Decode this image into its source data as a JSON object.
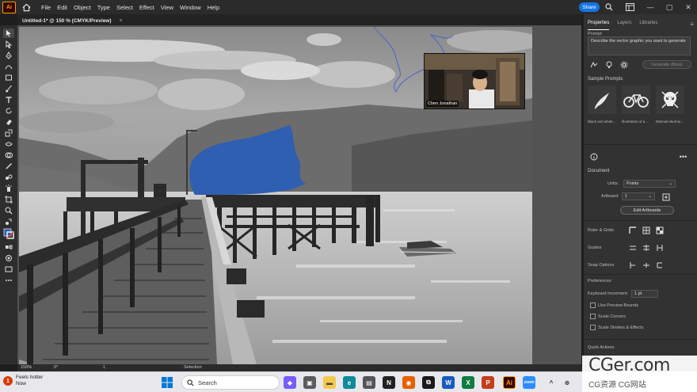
{
  "app": {
    "logo": "Ai",
    "menu": [
      "File",
      "Edit",
      "Object",
      "Type",
      "Select",
      "Effect",
      "View",
      "Window",
      "Help"
    ],
    "share_label": "Share"
  },
  "document": {
    "tab_title": "Untitled-1* @ 150 % (CMYK/Preview)",
    "close_glyph": "×"
  },
  "webcam": {
    "name": "Chen Jonathan"
  },
  "panel": {
    "tabs": [
      "Properties",
      "Layers",
      "Libraries"
    ],
    "prompt_header": "Prompt",
    "prompt_placeholder": "Describe the vector graphic you want to generate",
    "generate_label": "Generate (Beta)",
    "sample_prompts_title": "Sample Prompts",
    "samples": [
      {
        "caption": "Black and white...",
        "icon": "bird-icon"
      },
      {
        "caption": "Illustration of a...",
        "icon": "bicycle-icon"
      },
      {
        "caption": "Minimal skull wi...",
        "icon": "skull-icon"
      }
    ],
    "document_title": "Document",
    "units_label": "Units:",
    "units_value": "Points",
    "artboard_label": "Artboard:",
    "artboard_value": "1",
    "edit_artboards_label": "Edit Artboards",
    "ruler_grids_label": "Ruler & Grids",
    "guides_label": "Guides",
    "snap_options_label": "Snap Options",
    "preferences_title": "Preferences",
    "keyboard_increment_label": "Keyboard Increment:",
    "keyboard_increment_value": "1 pt",
    "checkboxes": [
      "Use Preview Bounds",
      "Scale Corners",
      "Scale Strokes & Effects"
    ],
    "quick_actions_title": "Quick Actions"
  },
  "status": {
    "zoom": "150%",
    "rotation": "0°",
    "artboard_nav": "1",
    "tool": "Selection"
  },
  "taskbar": {
    "weather_line1": "Feels hotter",
    "weather_line2": "Now",
    "weather_badge": "1",
    "search_label": "Search"
  },
  "watermark": {
    "big": "CGer.com",
    "small": "CG资源 CG网站"
  },
  "colors": {
    "accent": "#1473e6",
    "ai_orange": "#ff9a00",
    "paint_blue": "#2f5fb0"
  }
}
